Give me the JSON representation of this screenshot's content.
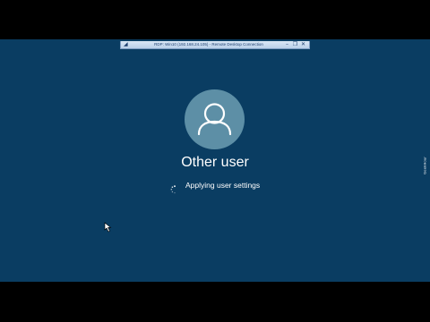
{
  "rdp_bar": {
    "title": "RDP: Win10 (192.168.24.105) - Remote Desktop Connection",
    "pin_icon": "pin-icon",
    "controls": [
      "minimize-icon",
      "restore-icon",
      "close-icon"
    ]
  },
  "login": {
    "user_name": "Other user",
    "status": "Applying user settings",
    "avatar_icon": "user-avatar-icon",
    "spinner_icon": "loading-spinner-icon"
  },
  "colors": {
    "background": "#0a3d62",
    "avatar": "#5d8fa6",
    "text": "#ffffff"
  },
  "watermark": {
    "text": "GeekHour"
  }
}
